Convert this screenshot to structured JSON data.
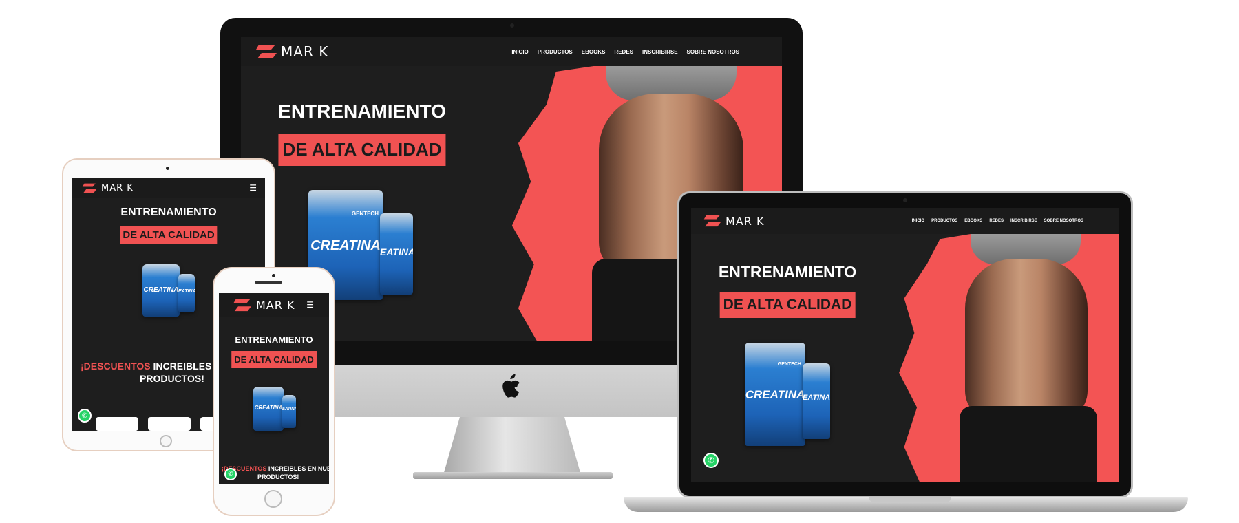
{
  "brand": {
    "name": "MAR K",
    "accent": "#f05252",
    "background": "#1e1e1e"
  },
  "nav": {
    "items": [
      "INICIO",
      "PRODUCTOS",
      "EBOOKS",
      "REDES",
      "INSCRIBIRSE",
      "SOBRE NOSOTROS"
    ],
    "menu_icon": "hamburger-icon"
  },
  "hero": {
    "title": "ENTRENAMIENTO",
    "subtitle": "DE ALTA CALIDAD",
    "product_label": "CREATINA",
    "product_label_short": "EATINA",
    "product_brand": "GENTECH"
  },
  "promo": {
    "highlight": "¡DESCUENTOS",
    "tablet_rest": "INCREIBLES EN N",
    "tablet_line2": "PRODUCTOS!",
    "phone_rest": "INCREIBLES EN NUESTROS",
    "phone_line2": "PRODUCTOS!"
  },
  "icons": {
    "whatsapp": "whatsapp-icon",
    "apple": "apple-logo-icon",
    "logo": "lightning-logo-icon"
  }
}
